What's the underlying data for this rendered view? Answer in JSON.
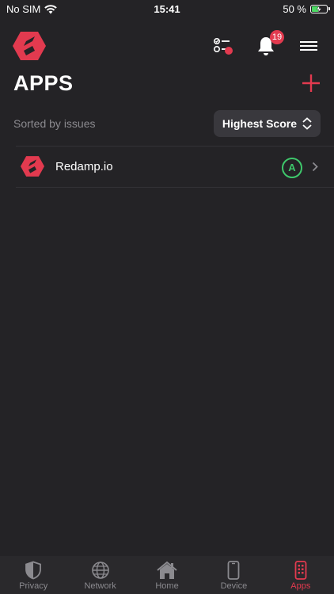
{
  "status_bar": {
    "carrier": "No SIM",
    "time": "15:41",
    "battery_text": "50 %",
    "battery_level": 0.5,
    "icons": [
      "wifi-icon",
      "battery-icon",
      "charging-icon"
    ]
  },
  "header": {
    "logo_icon": "redamp-logo-icon",
    "notification_count": "19",
    "icons": [
      "checklist-icon",
      "bell-icon",
      "hamburger-menu-icon"
    ]
  },
  "page": {
    "title": "APPS",
    "add_icon": "plus-icon"
  },
  "sort": {
    "label": "Sorted by issues",
    "button_label": "Highest Score",
    "button_icon": "sort-arrows-icon"
  },
  "apps": [
    {
      "name": "Redamp.io",
      "grade": "A",
      "icon": "redamp-app-icon"
    }
  ],
  "tabs": [
    {
      "label": "Privacy",
      "icon": "shield-icon",
      "active": false
    },
    {
      "label": "Network",
      "icon": "globe-icon",
      "active": false
    },
    {
      "label": "Home",
      "icon": "home-icon",
      "active": false
    },
    {
      "label": "Device",
      "icon": "phone-icon",
      "active": false
    },
    {
      "label": "Apps",
      "icon": "apps-icon",
      "active": true
    }
  ],
  "colors": {
    "background": "#242326",
    "accent": "#e23a4f",
    "grade_green": "#3ec76b",
    "muted_text": "#8b8a8f",
    "button_bg": "#39383d"
  }
}
